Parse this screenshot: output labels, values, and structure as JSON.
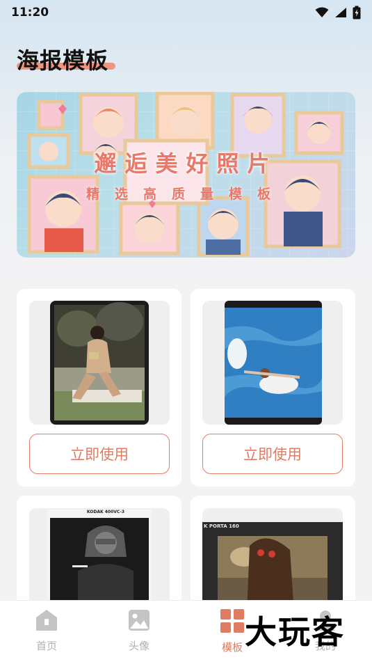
{
  "status": {
    "time": "11:20"
  },
  "page": {
    "title": "海报模板"
  },
  "banner": {
    "title": "邂逅美好照片",
    "subtitle": "精选高质量模板"
  },
  "cards": [
    {
      "button_label": "立即使用",
      "film_label": ""
    },
    {
      "button_label": "立即使用",
      "film_label": ""
    },
    {
      "button_label": "",
      "film_label": "KODAK 400VC-3"
    },
    {
      "button_label": "",
      "film_label": "K PORTA 160"
    }
  ],
  "tabs": [
    {
      "label": "首页",
      "icon": "home-icon",
      "active": false
    },
    {
      "label": "头像",
      "icon": "image-icon",
      "active": false
    },
    {
      "label": "模板",
      "icon": "grid-icon",
      "active": true
    },
    {
      "label": "我的",
      "icon": "user-icon",
      "active": false
    }
  ],
  "watermark": {
    "text": "大玩客"
  },
  "colors": {
    "accent": "#e07c63",
    "title_underline": "#f08c73",
    "banner_text": "#e8786a"
  }
}
